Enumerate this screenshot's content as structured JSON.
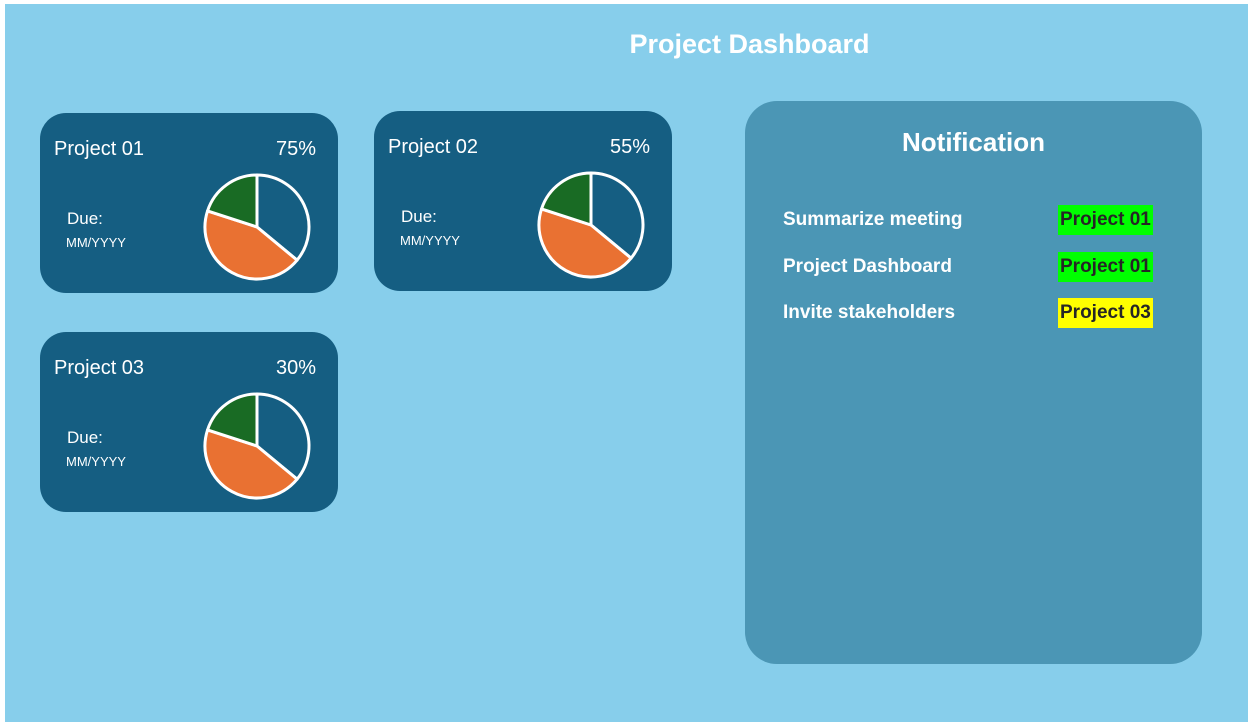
{
  "header": {
    "title": "Project Dashboard"
  },
  "colors": {
    "page_bg": "#87CEEB",
    "card_bg": "#155E82",
    "panel_bg": "#4B96B5",
    "pie_blue": "#155E82",
    "pie_orange": "#E97132",
    "pie_green": "#196B24",
    "tag_green": "#00FF00",
    "tag_yellow": "#FFFF00"
  },
  "projects": [
    {
      "name": "Project 01",
      "percent": "75%",
      "due_label": "Due:",
      "due_value": "MM/YYYY"
    },
    {
      "name": "Project 02",
      "percent": "55%",
      "due_label": "Due:",
      "due_value": "MM/YYYY"
    },
    {
      "name": "Project 03",
      "percent": "30%",
      "due_label": "Due:",
      "due_value": "MM/YYYY"
    }
  ],
  "pie_slices": [
    {
      "color_key": "pie_blue",
      "fraction": 0.36
    },
    {
      "color_key": "pie_orange",
      "fraction": 0.44
    },
    {
      "color_key": "pie_green",
      "fraction": 0.2
    }
  ],
  "notifications": {
    "title": "Notification",
    "items": [
      {
        "text": "Summarize meeting",
        "tag": "Project 01",
        "tag_color": "#00FF00"
      },
      {
        "text": "Project Dashboard",
        "tag": "Project 01",
        "tag_color": "#00FF00"
      },
      {
        "text": "Invite stakeholders",
        "tag": "Project 03",
        "tag_color": "#FFFF00"
      }
    ]
  }
}
